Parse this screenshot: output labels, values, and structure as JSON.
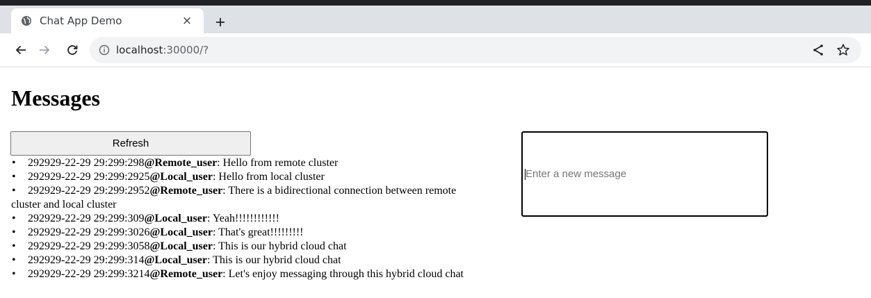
{
  "browser": {
    "tab_title": "Chat App Demo",
    "tab_close": "×",
    "new_tab": "+",
    "url_host": "localhost",
    "url_path": ":30000/?"
  },
  "page": {
    "title": "Messages",
    "refresh_label": "Refresh",
    "input_placeholder": "Enter a new message",
    "messages": [
      {
        "timestamp": "292929-22-29 29:299:298",
        "user": "@Remote_user",
        "text": ": Hello from remote cluster"
      },
      {
        "timestamp": "292929-22-29 29:299:2925",
        "user": "@Local_user",
        "text": ": Hello from local cluster"
      },
      {
        "timestamp": "292929-22-29 29:299:2952",
        "user": "@Remote_user",
        "text": ": There is a bidirectional connection between remote cluster and local cluster"
      },
      {
        "timestamp": "292929-22-29 29:299:309",
        "user": "@Local_user",
        "text": ": Yeah!!!!!!!!!!!!"
      },
      {
        "timestamp": "292929-22-29 29:299:3026",
        "user": "@Local_user",
        "text": ": That's great!!!!!!!!!"
      },
      {
        "timestamp": "292929-22-29 29:299:3058",
        "user": "@Local_user",
        "text": ": This is our hybrid cloud chat"
      },
      {
        "timestamp": "292929-22-29 29:299:314",
        "user": "@Local_user",
        "text": ": This is our hybrid cloud chat"
      },
      {
        "timestamp": "292929-22-29 29:299:3214",
        "user": "@Remote_user",
        "text": ": Let's enjoy messaging through this hybrid cloud chat"
      }
    ]
  },
  "icons": {
    "tab_favicon": "globe-icon",
    "back": "arrow-left-icon",
    "forward": "arrow-right-icon",
    "reload": "reload-icon",
    "site_info": "info-icon",
    "share": "share-icon",
    "bookmark": "star-icon"
  }
}
